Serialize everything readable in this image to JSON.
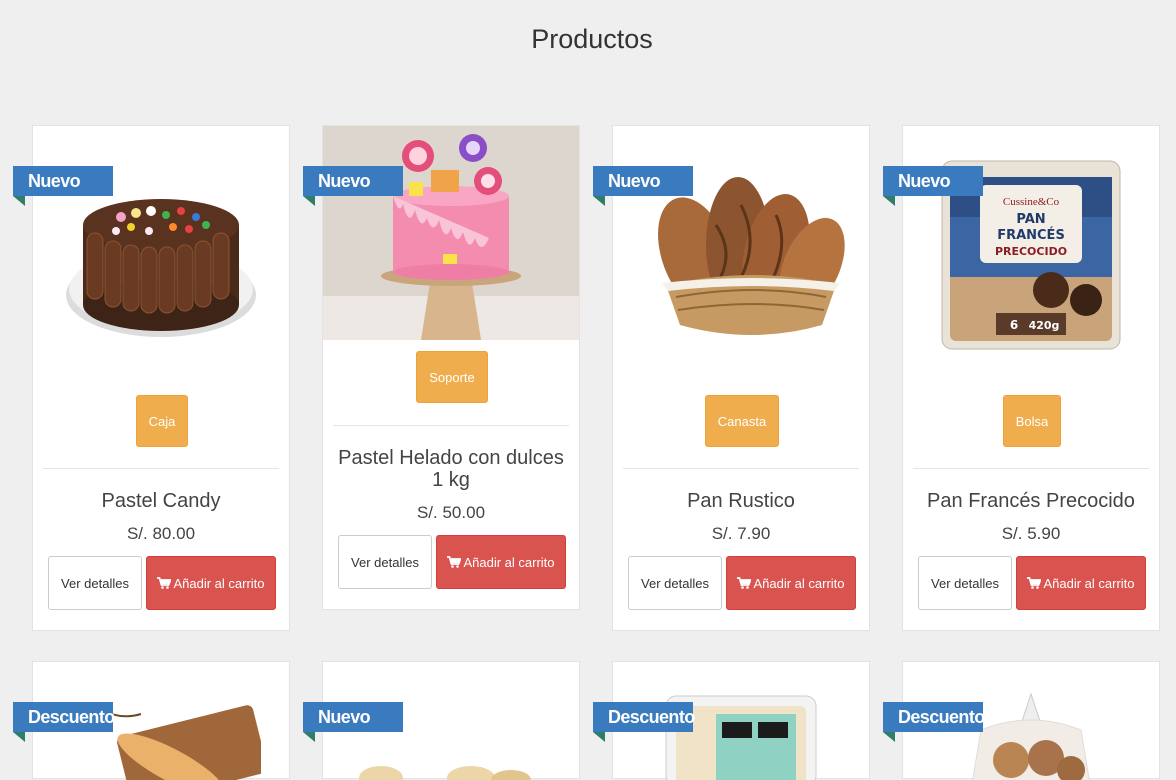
{
  "page": {
    "title": "Productos"
  },
  "common": {
    "details_label": "Ver detalles",
    "cart_label": "Añadir al carrito"
  },
  "products": [
    {
      "ribbon": "Nuevo",
      "tag": "Caja",
      "name": "Pastel Candy",
      "price": "S/. 80.00",
      "image": "chocolate-candy-cake"
    },
    {
      "ribbon": "Nuevo",
      "tag": "Soporte",
      "name": "Pastel Helado con dulces 1 kg",
      "price": "S/. 50.00",
      "image": "pink-drip-cake"
    },
    {
      "ribbon": "Nuevo",
      "tag": "Canasta",
      "name": "Pan Rustico",
      "price": "S/. 7.90",
      "image": "bread-basket"
    },
    {
      "ribbon": "Nuevo",
      "tag": "Bolsa",
      "name": "Pan Francés Precocido",
      "price": "S/. 5.90",
      "image": "bread-bag"
    },
    {
      "ribbon": "Descuento",
      "image": "baguette"
    },
    {
      "ribbon": "Nuevo",
      "image": "bread-rolls"
    },
    {
      "ribbon": "Descuento",
      "image": "packaged-crackers"
    },
    {
      "ribbon": "Descuento",
      "image": "bagged-buns"
    }
  ],
  "colors": {
    "ribbon": "#3a7abf",
    "tag_button": "#f0ad4e",
    "cart_button": "#d9534f"
  },
  "package_text": {
    "brand": "Cussine&Co",
    "title_line1": "PAN",
    "title_line2": "FRANCÉS",
    "title_line3": "PRECOCIDO",
    "units": "6",
    "weight": "420g"
  }
}
